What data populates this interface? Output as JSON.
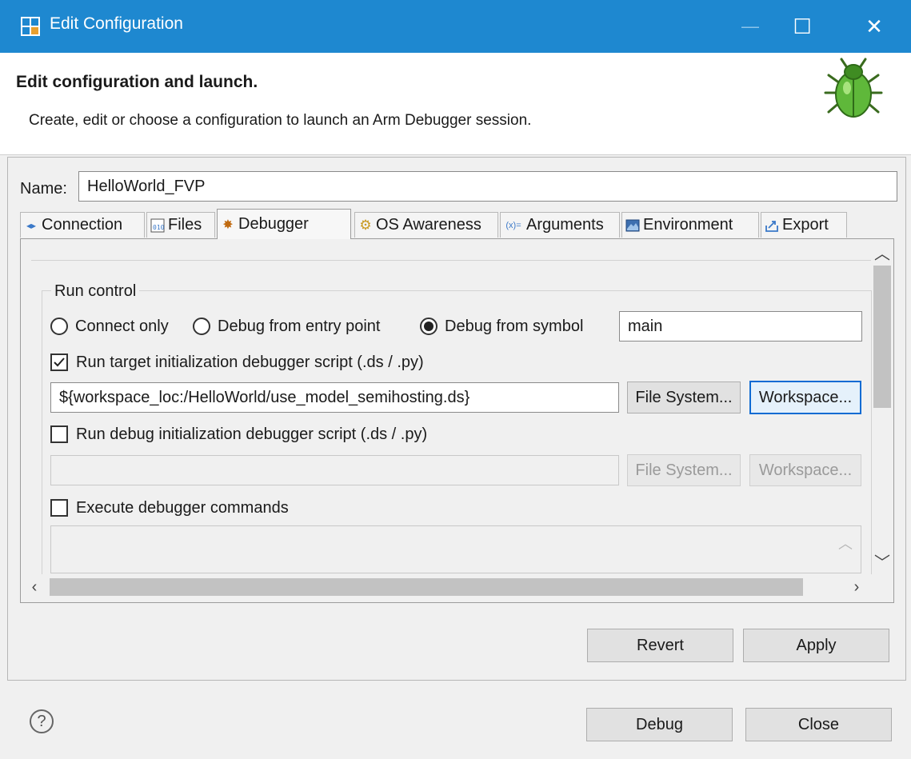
{
  "window": {
    "title": "Edit Configuration",
    "minimize_glyph": "—",
    "maximize_glyph": "☐",
    "close_glyph": "✕"
  },
  "header": {
    "title": "Edit configuration and launch.",
    "description": "Create, edit or choose a configuration to launch an Arm Debugger session."
  },
  "config": {
    "name_label": "Name:",
    "name_value": "HelloWorld_FVP"
  },
  "tabs": [
    {
      "label": "Connection",
      "icon": "connection-icon",
      "active": false
    },
    {
      "label": "Files",
      "icon": "files-icon",
      "active": false
    },
    {
      "label": "Debugger",
      "icon": "debugger-bug-icon",
      "active": true
    },
    {
      "label": "OS Awareness",
      "icon": "os-awareness-gear-icon",
      "active": false
    },
    {
      "label": "Arguments",
      "icon": "arguments-icon",
      "active": false
    },
    {
      "label": "Environment",
      "icon": "environment-icon",
      "active": false
    },
    {
      "label": "Export",
      "icon": "export-icon",
      "active": false
    }
  ],
  "run_control": {
    "group_label": "Run control",
    "radios": [
      {
        "label": "Connect only",
        "selected": false
      },
      {
        "label": "Debug from entry point",
        "selected": false
      },
      {
        "label": "Debug from symbol",
        "selected": true
      }
    ],
    "symbol_value": "main",
    "target_script": {
      "label": "Run target initialization debugger script (.ds / .py)",
      "checked": true,
      "path": "${workspace_loc:/HelloWorld/use_model_semihosting.ds}",
      "file_system_button": "File System...",
      "workspace_button": "Workspace..."
    },
    "debug_script": {
      "label": "Run debug initialization debugger script (.ds / .py)",
      "checked": false,
      "path": "",
      "file_system_button": "File System...",
      "workspace_button": "Workspace..."
    },
    "commands": {
      "label": "Execute debugger commands",
      "checked": false
    }
  },
  "buttons": {
    "revert": "Revert",
    "apply": "Apply",
    "debug": "Debug",
    "close": "Close",
    "help_glyph": "?"
  },
  "colors": {
    "titlebar": "#1e88d0",
    "focus_border": "#0f6bd3"
  }
}
